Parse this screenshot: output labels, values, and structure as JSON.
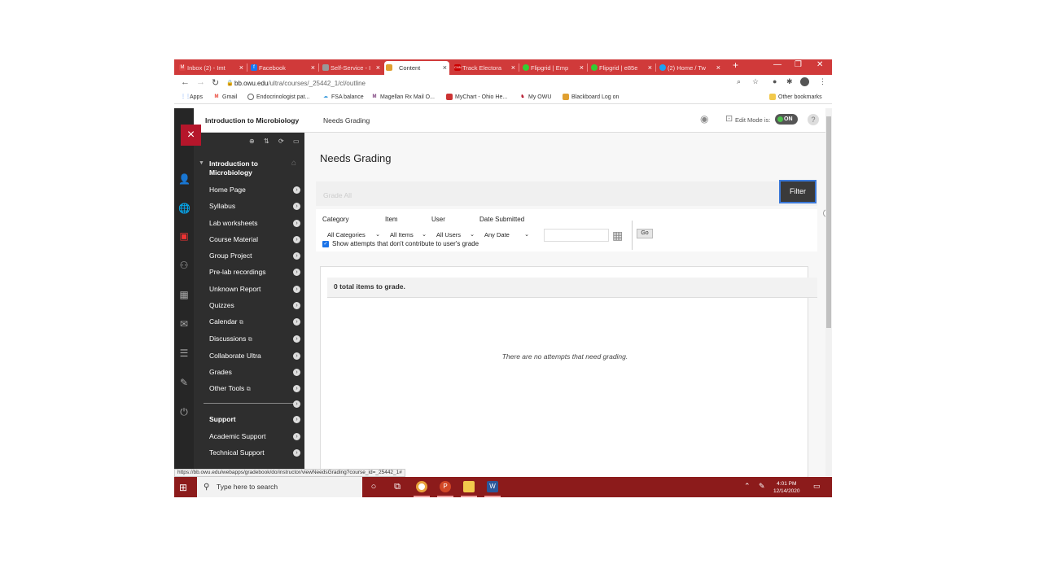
{
  "browser": {
    "tabs": [
      {
        "label": "Inbox (2) - Imt",
        "color": "#d44"
      },
      {
        "label": "Facebook",
        "color": "#1877f2"
      },
      {
        "label": "Self-Service - I",
        "color": "#999"
      },
      {
        "label": "Content",
        "color": "#e0a030"
      },
      {
        "label": "Track Electora",
        "color": "#c00"
      },
      {
        "label": "Flipgrid | Emp",
        "color": "#3c3"
      },
      {
        "label": "Flipgrid | e85e",
        "color": "#3c3"
      },
      {
        "label": "(2) Home / Tw",
        "color": "#1da1f2"
      }
    ],
    "new_tab": "+",
    "window_controls": [
      "—",
      "❐",
      "✕"
    ],
    "url_host": "bb.owu.edu",
    "url_path": "/ultra/courses/_25442_1/cl/outline",
    "bookmarks": [
      {
        "label": "Apps",
        "color": "#4285f4"
      },
      {
        "label": "Gmail",
        "color": "#ea4335"
      },
      {
        "label": "Endocrinologist pat...",
        "color": "#666"
      },
      {
        "label": "FSA balance",
        "color": "#4aa3df"
      },
      {
        "label": "Magellan Rx Mail O...",
        "color": "#7a3b7a"
      },
      {
        "label": "MyChart - Ohio He...",
        "color": "#c33"
      },
      {
        "label": "My OWU",
        "color": "#b5162b"
      },
      {
        "label": "Blackboard Log on",
        "color": "#e0a030"
      }
    ],
    "other_bookmarks": "Other bookmarks",
    "status_url": "https://bb.owu.edu/webapps/gradebook/do/instructor/viewNeedsGrading?course_id=_25442_1#"
  },
  "header": {
    "course_title": "Introduction to Microbiology",
    "breadcrumb": "Needs Grading",
    "edit_mode_label": "Edit Mode is:",
    "edit_mode_value": "ON",
    "help": "?"
  },
  "menu": {
    "title": "Introduction to Microbiology",
    "items": [
      "Home Page",
      "Syllabus",
      "Lab worksheets",
      "Course Material",
      "Group Project",
      "Pre-lab recordings",
      "Unknown Report",
      "Quizzes",
      "Calendar",
      "Discussions",
      "Collaborate Ultra",
      "Grades",
      "Other Tools"
    ],
    "support_heading": "Support",
    "support_items": [
      "Academic Support",
      "Technical Support"
    ]
  },
  "main": {
    "page_title": "Needs Grading",
    "grade_all": "Grade All",
    "filter_button": "Filter",
    "filters": {
      "category_label": "Category",
      "category_value": "All Categories",
      "item_label": "Item",
      "item_value": "All Items",
      "user_label": "User",
      "user_value": "All Users",
      "date_label": "Date Submitted",
      "date_value": "Any Date",
      "go": "Go",
      "show_attempts": "Show attempts that don't contribute to user's grade"
    },
    "total_items": "0 total items to grade.",
    "empty_message": "There are no attempts that need grading."
  },
  "taskbar": {
    "search_placeholder": "Type here to search",
    "time": "4:01 PM",
    "date": "12/14/2020"
  }
}
